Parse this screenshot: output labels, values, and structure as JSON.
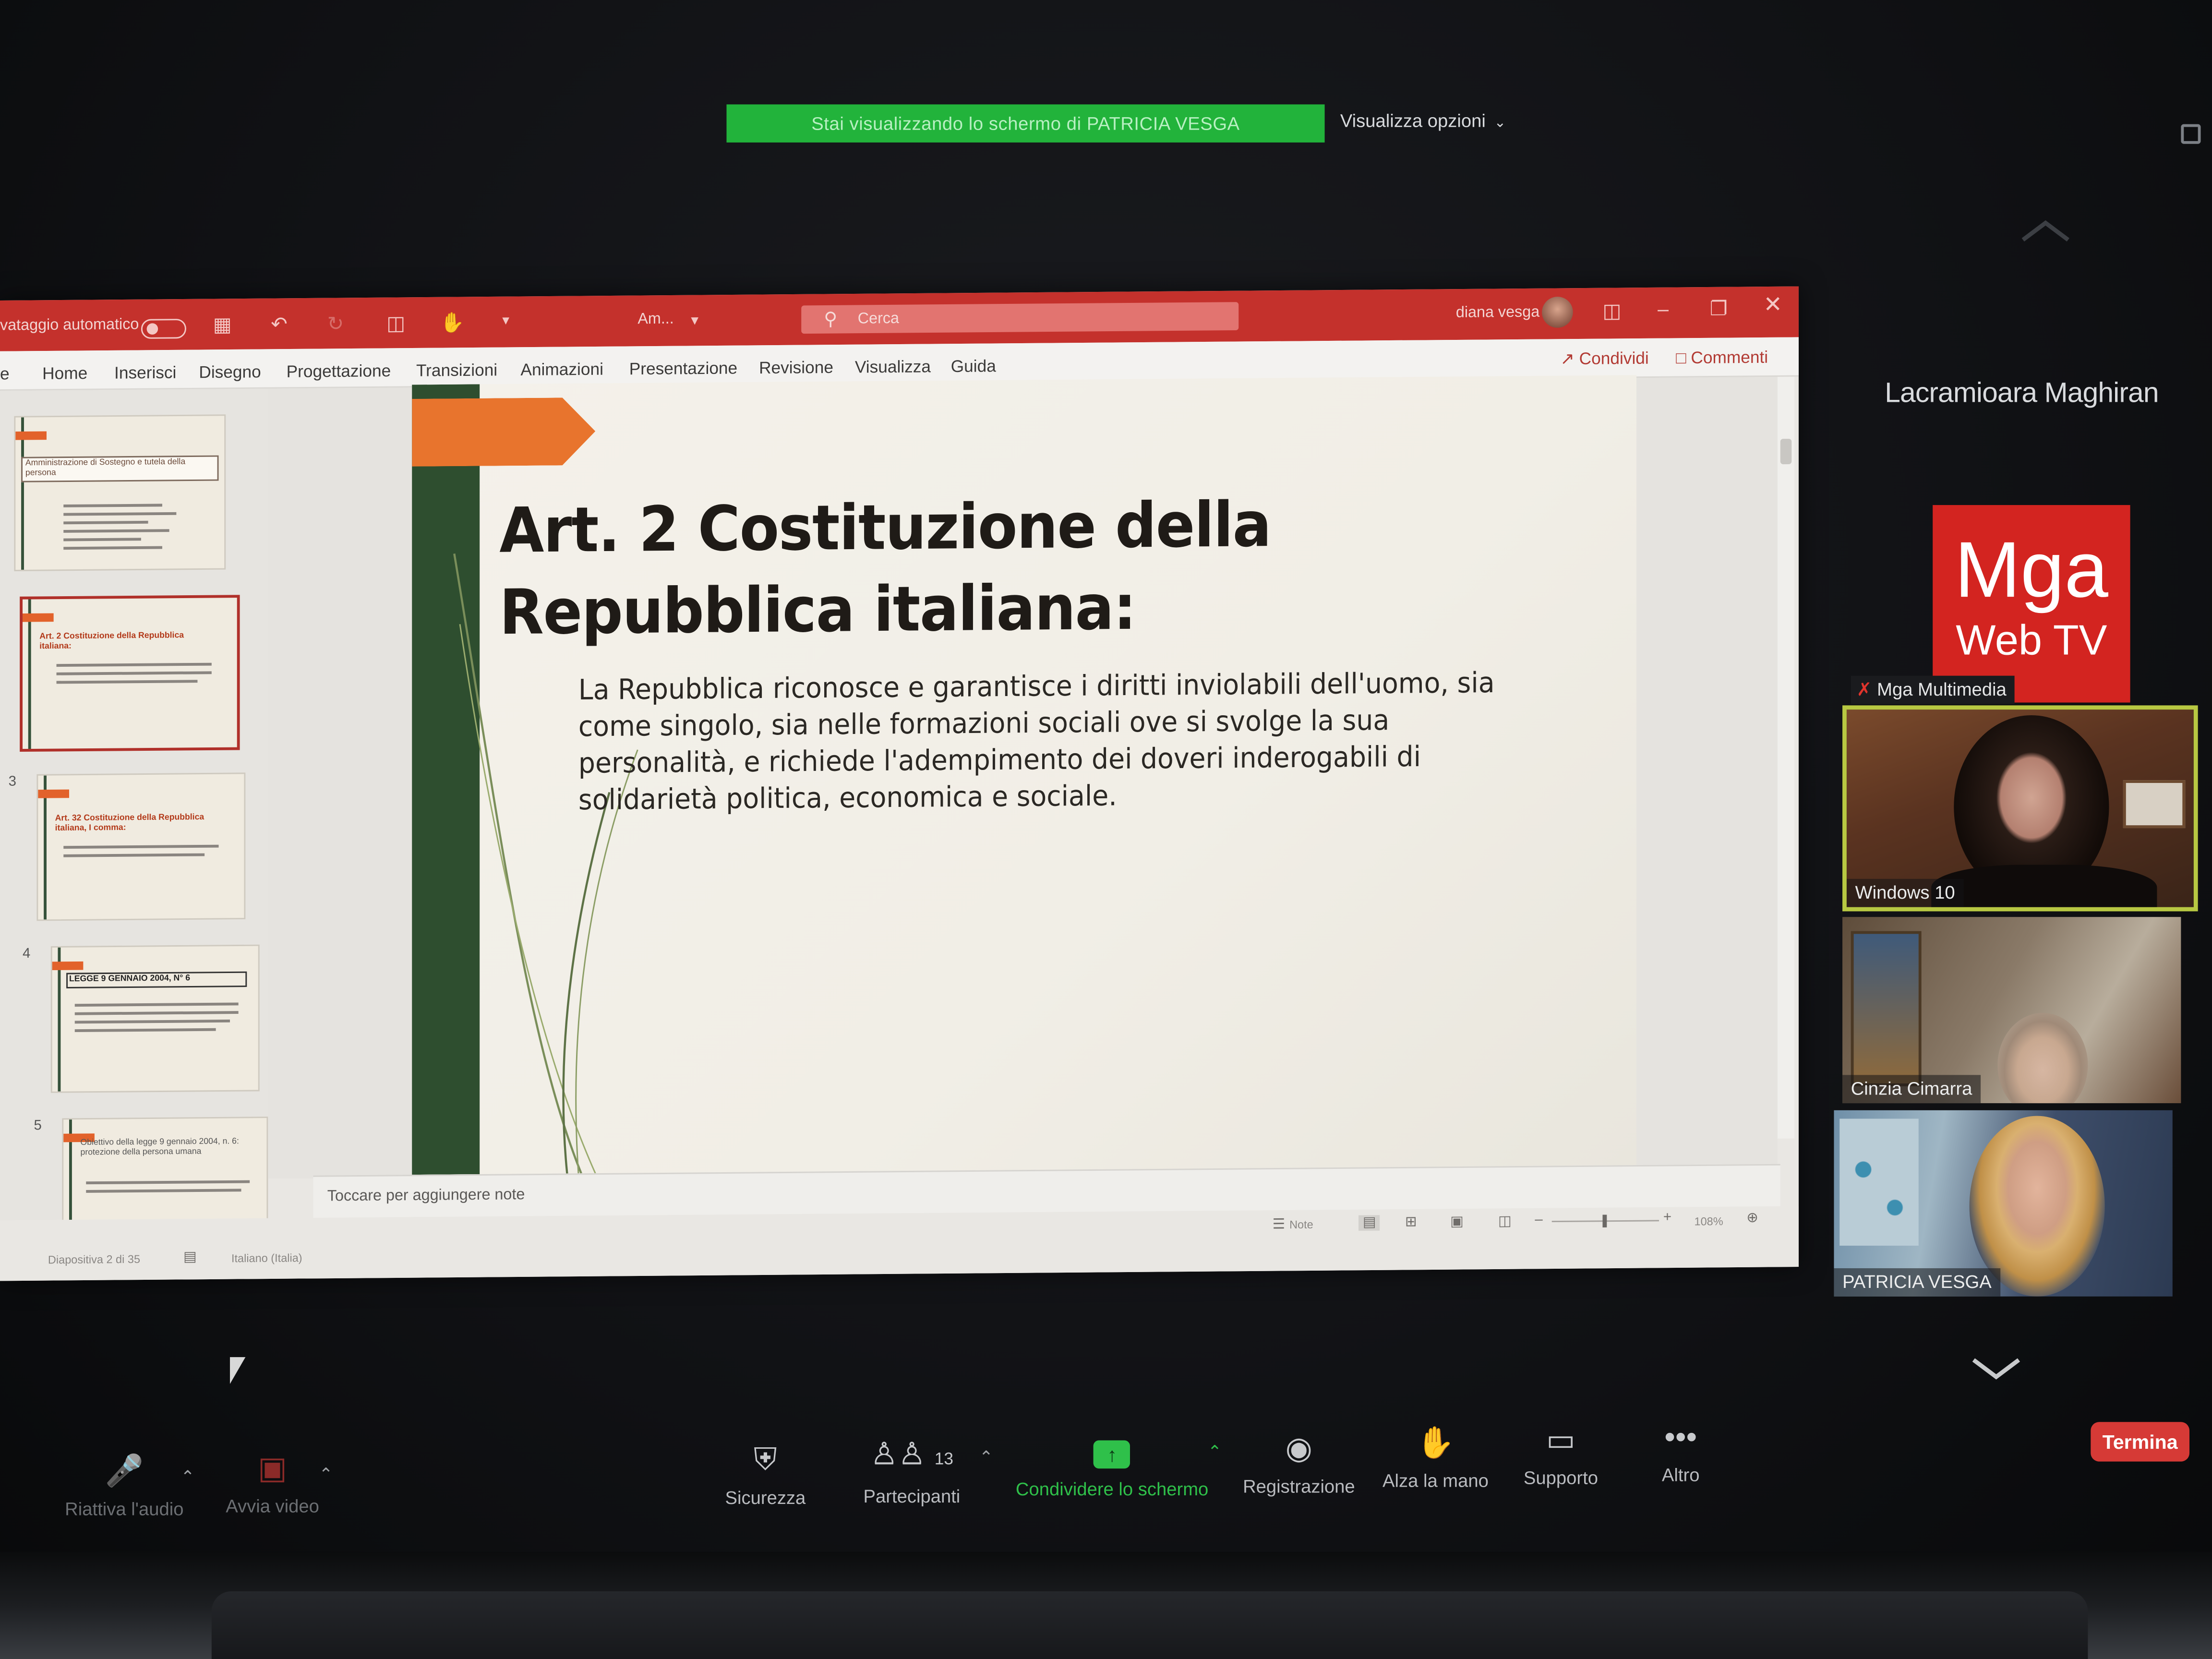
{
  "banner": {
    "sharing_text": "Stai visualizzando lo schermo di PATRICIA VESGA",
    "view_options": "Visualizza opzioni"
  },
  "ppt": {
    "autosave_label": "vataggio automatico",
    "file_name": "Am...",
    "search_placeholder": "Cerca",
    "user_name": "diana vesga",
    "menu": [
      "e",
      "Home",
      "Inserisci",
      "Disegno",
      "Progettazione",
      "Transizioni",
      "Animazioni",
      "Presentazione",
      "Revisione",
      "Visualizza",
      "Guida"
    ],
    "share_label": "Condividi",
    "comments_label": "Commenti",
    "thumbnails": [
      {
        "num": "",
        "title": "Amministrazione di Sostegno e tutela della persona"
      },
      {
        "num": "2",
        "title": "Art. 2 Costituzione della Repubblica italiana:"
      },
      {
        "num": "3",
        "title": "Art. 32 Costituzione della Repubblica italiana, I comma:"
      },
      {
        "num": "4",
        "title": "LEGGE 9 GENNAIO 2004, N° 6"
      },
      {
        "num": "5",
        "title": "Obiettivo della legge 9 gennaio 2004, n. 6: protezione della persona umana"
      }
    ],
    "slide": {
      "title": "Art. 2 Costituzione della Repubblica italiana:",
      "body": "La Repubblica riconosce e garantisce i diritti inviolabili dell'uomo, sia come singolo, sia nelle formazioni sociali ove si svolge la sua personalità, e richiede l'adempimento dei doveri inderogabili di solidarietà politica, economica e sociale."
    },
    "notes_placeholder": "Toccare per aggiungere note",
    "status": {
      "slide_counter": "Diapositiva 2 di 35",
      "language": "Italiano (Italia)",
      "notes_label": "Note",
      "zoom": "108%"
    }
  },
  "gallery": {
    "active_speaker": "Lacramioara Maghiran",
    "logo_line1": "Mga",
    "logo_line2": "Web TV",
    "participants": [
      {
        "name": "Mga Multimedia"
      },
      {
        "name": "Windows 10"
      },
      {
        "name": "Cinzia Cimarra"
      },
      {
        "name": "PATRICIA VESGA"
      }
    ]
  },
  "toolbar": {
    "unmute": "Riattiva l'audio",
    "start_video": "Avvia video",
    "security": "Sicurezza",
    "participants": "Partecipanti",
    "participants_count": "13",
    "share_screen": "Condividere lo schermo",
    "record": "Registrazione",
    "raise_hand": "Alza la mano",
    "support": "Supporto",
    "more": "Altro",
    "end": "Termina"
  },
  "colors": {
    "banner_green": "#22b33b",
    "ppt_red": "#c4312c",
    "slide_orange": "#e8742d",
    "slide_green": "#2e4e2f",
    "end_red": "#d63a36",
    "active_border": "#b8c842"
  }
}
